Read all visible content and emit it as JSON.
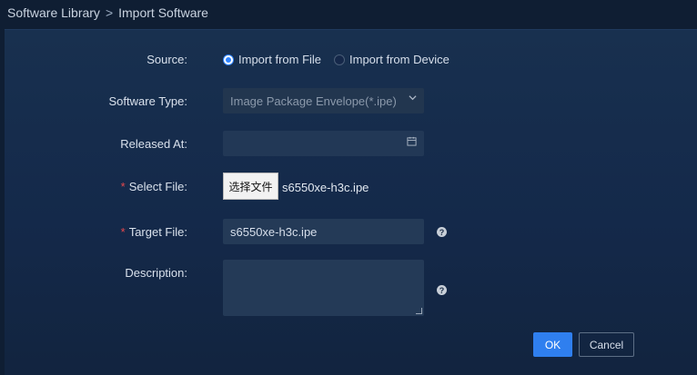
{
  "breadcrumb": {
    "parent": "Software Library",
    "separator": ">",
    "current": "Import Software"
  },
  "form": {
    "source": {
      "label": "Source:",
      "options": [
        {
          "label": "Import from File",
          "selected": true
        },
        {
          "label": "Import from Device",
          "selected": false
        }
      ]
    },
    "software_type": {
      "label": "Software Type:",
      "value": "Image Package Envelope(*.ipe)",
      "icon": "chevron-down-icon"
    },
    "released_at": {
      "label": "Released At:",
      "value": "",
      "icon": "calendar-icon"
    },
    "select_file": {
      "required_mark": "*",
      "label": "Select File:",
      "button_label": "选择文件",
      "filename": "s6550xe-h3c.ipe"
    },
    "target_file": {
      "required_mark": "*",
      "label": "Target File:",
      "value": "s6550xe-h3c.ipe",
      "help": "?"
    },
    "description": {
      "label": "Description:",
      "value": "",
      "help": "?"
    }
  },
  "actions": {
    "ok": "OK",
    "cancel": "Cancel"
  },
  "colors": {
    "accent": "#2f7fef",
    "required": "#e5484d",
    "panel": "#18304f",
    "page": "#0f1e33"
  }
}
